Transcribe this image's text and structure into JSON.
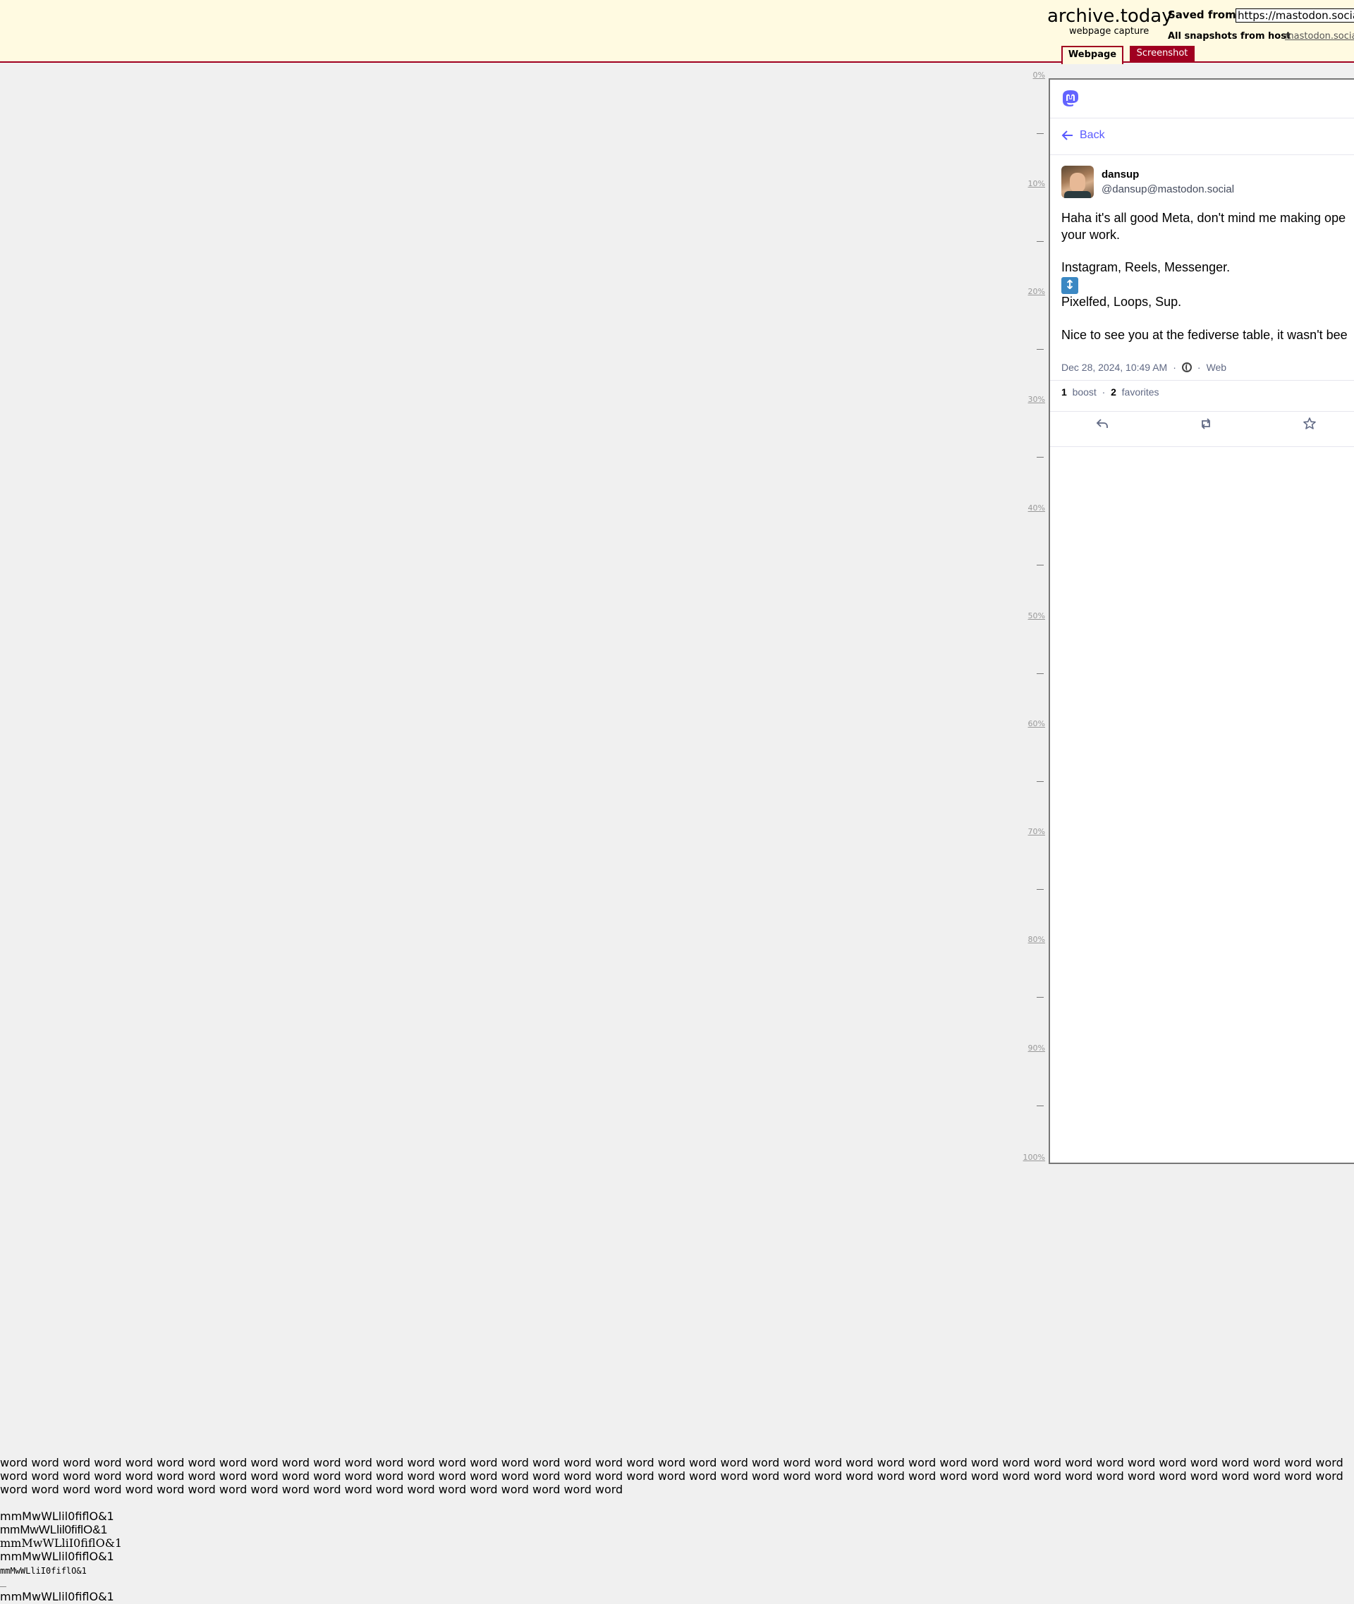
{
  "archive": {
    "logo_title": "archive.today",
    "logo_subtitle": "webpage capture",
    "saved_from_label": "Saved from",
    "saved_url": "https://mastodon.social/@",
    "snapshots_label": "All snapshots  from host",
    "snapshots_host": "mastodon.social",
    "tabs": {
      "webpage": "Webpage",
      "screenshot": "Screenshot"
    }
  },
  "ruler": {
    "labels": [
      "0%",
      "10%",
      "20%",
      "30%",
      "40%",
      "50%",
      "60%",
      "70%",
      "80%",
      "90%",
      "100%"
    ]
  },
  "captured_page": {
    "back_label": "Back",
    "display_name": "dansup",
    "account": "@dansup@mastodon.social",
    "post": {
      "line1": "Haha it's all good Meta, don't mind me making ope",
      "line2": "your work.",
      "line3": "Instagram, Reels, Messenger.",
      "emoji": "↕",
      "line4": "Pixelfed, Loops, Sup.",
      "line5": "Nice to see you at the fediverse table, it wasn't bee"
    },
    "timestamp": "Dec 28, 2024, 10:49 AM",
    "meta_separator": "·",
    "application": "Web",
    "boost_count": "1",
    "boost_label": "boost",
    "favorite_count": "2",
    "favorite_label": "favorites",
    "icons": [
      "mastodon-logo-icon",
      "back-arrow-icon",
      "globe-icon",
      "reply-icon",
      "boost-icon",
      "favorite-star-icon"
    ]
  },
  "bottom_text": {
    "words_line1": "word word word word word word word word word word word word word word word word word word word word word word word word word word word word word word word word word word word word word word word word word word word",
    "words_line2": "word word word word word word word word word word word word word word word word word word word word word word word word word word word word word word word word word word word word word word word word word word word",
    "words_line3": "word word word word word word word word word word word word word word word word word word word word",
    "glyph_lines": [
      "mmMwWLlil0fiflO&1",
      "mmMwWLlil0fiflO&1",
      "mmMwWLliI0fiflO&1",
      "mmMwWLlil0fiflO&1",
      "mmMwWLliI0fiflO&1",
      "mmMwWLlil0fiflO&1"
    ]
  }
}
